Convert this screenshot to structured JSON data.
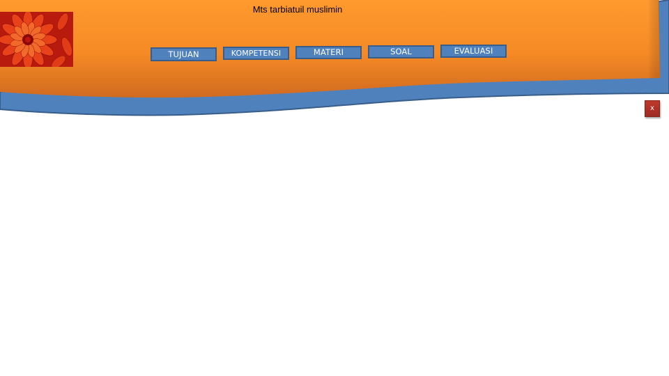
{
  "header": {
    "title": "Mts tarbiatuil muslimin",
    "colors": {
      "orange_top": "#ff9a2e",
      "orange_bottom": "#d86a1c",
      "blue_wave": "#4f81bd",
      "blue_border": "#385d8a"
    }
  },
  "logo": {
    "icon": "flower-icon",
    "colors": [
      "#c0150f",
      "#e8421a",
      "#f26a2a",
      "#8a0a08"
    ]
  },
  "nav": {
    "tujuan": "TUJUAN",
    "kompetensi": "KOMPETENSI",
    "materi": "MATERI",
    "soal": "SOAL",
    "evaluasi": "EVALUASI"
  },
  "close_button": {
    "label": "x",
    "color": "#b23027"
  }
}
